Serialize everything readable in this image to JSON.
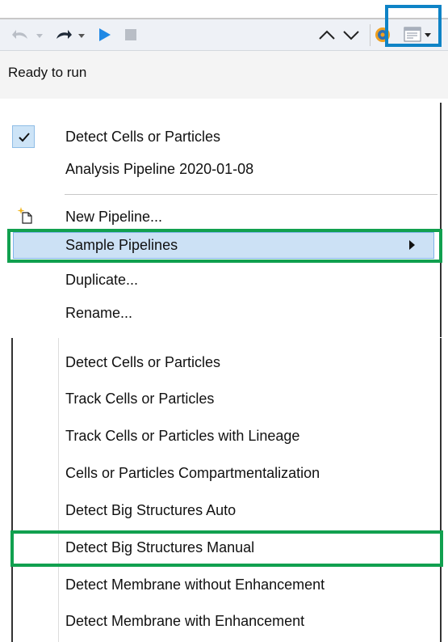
{
  "toolbar": {
    "icons": [
      "undo-arrow-icon",
      "undo-dropdown-icon",
      "redo-arrow-icon",
      "redo-dropdown-icon",
      "run-play-icon",
      "stop-icon",
      "chevron-up-icon",
      "chevron-down-icon",
      "gear-globe-icon",
      "pipeline-dropdown-icon"
    ],
    "status": "Ready to run"
  },
  "menu": {
    "checked_item": "Detect Cells or Particles",
    "items": [
      {
        "label": "Analysis Pipeline 2020-01-08"
      },
      {
        "label": "New Pipeline...",
        "icon": "new-document-icon"
      },
      {
        "label": "Sample Pipelines",
        "has_submenu": true
      },
      {
        "label": "Duplicate..."
      },
      {
        "label": "Rename..."
      }
    ]
  },
  "submenu": {
    "items": [
      "Detect Cells or Particles",
      "Track Cells or Particles",
      "Track Cells or Particles with Lineage",
      "Cells or Particles Compartmentalization",
      "Detect Big Structures Auto",
      "Detect Big Structures Manual",
      "Detect Membrane without Enhancement",
      "Detect Membrane with Enhancement"
    ]
  },
  "colors": {
    "highlight_blue": "#0e83c6",
    "highlight_green": "#11a04f",
    "play_blue": "#1e88e5",
    "menu_selected_bg": "#cce1f5"
  }
}
